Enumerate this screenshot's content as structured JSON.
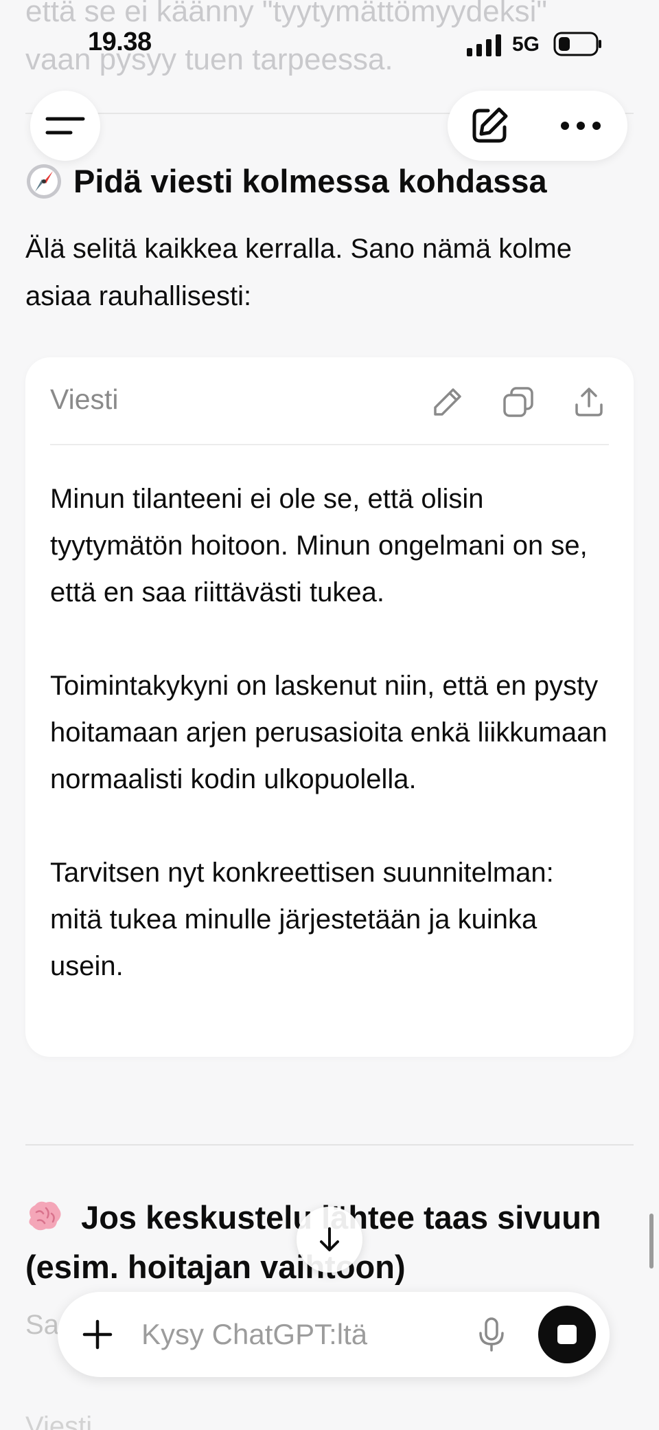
{
  "previous_message": {
    "line1": "että se ei käänny \"tyytymättömyydeksi\"",
    "line2": "vaan pysyy tuen tarpeessa."
  },
  "status_bar": {
    "time": "19.38",
    "network": "5G",
    "signal_icon": "cellular-signal-icon",
    "battery_icon": "battery-icon"
  },
  "top_nav": {
    "menu_icon": "hamburger-menu-icon",
    "edit_icon": "new-chat-edit-icon",
    "more_icon": "more-options-icon"
  },
  "section1": {
    "emoji": "compass-emoji",
    "title": "Pidä viesti kolmessa kohdassa",
    "intro": "Älä selitä kaikkea kerralla. Sano nämä kolme asiaa rauhallisesti:"
  },
  "message_card": {
    "title": "Viesti",
    "icons": [
      "pencil-icon",
      "copy-icon",
      "share-icon"
    ],
    "paragraphs": [
      "Minun tilanteeni ei ole se, että olisin tyytymätön hoitoon. Minun ongelmani on se, että en saa riittävästi tukea.",
      "Toimintakykyni on laskenut niin, että en pysty hoitamaan arjen perusasioita enkä liikkumaan normaalisti kodin ulkopuolella.",
      "Tarvitsen nyt konkreettisen suunnitelman: mitä tukea minulle järjestetään ja kuinka usein."
    ]
  },
  "section2": {
    "emoji": "brain-emoji",
    "title": "Jos keskustelu lähtee taas sivuun (esim. hoitajan vaihtoon)"
  },
  "faded_below": {
    "text_start": "Sa",
    "next_card_title": "Viesti"
  },
  "composer": {
    "placeholder": "Kysy ChatGPT:ltä",
    "plus_icon": "plus-icon",
    "mic_icon": "microphone-icon",
    "stop_icon": "stop-icon"
  },
  "scroll_down_icon": "arrow-down-icon"
}
